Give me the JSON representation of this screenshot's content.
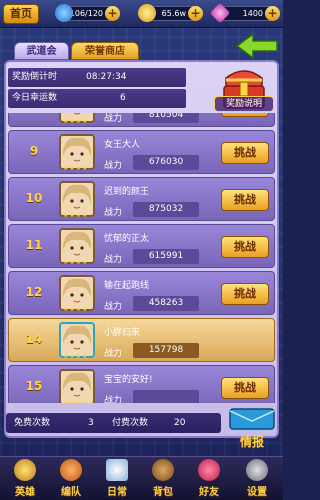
{
  "topbar": {
    "home_label": "首页",
    "stamina": "106/120",
    "gold": "65.6w",
    "diamond": "1400"
  },
  "tabs": {
    "arena": "武道会",
    "honor_shop": "荣誉商店"
  },
  "info": {
    "countdown_label": "奖励倒计时",
    "countdown_value": "08:27:34",
    "luck_label": "今日幸运数",
    "luck_value": "6",
    "reward_label": "奖励说明"
  },
  "rows": [
    {
      "rank": "",
      "name": "",
      "power_label": "战力",
      "power": "810504",
      "challenge": "挑战"
    },
    {
      "rank": "9",
      "name": "女王大人",
      "power_label": "战力",
      "power": "676030",
      "challenge": "挑战"
    },
    {
      "rank": "10",
      "name": "迟到的颜王",
      "power_label": "战力",
      "power": "875032",
      "challenge": "挑战"
    },
    {
      "rank": "11",
      "name": "忧郁的正太",
      "power_label": "战力",
      "power": "615991",
      "challenge": "挑战"
    },
    {
      "rank": "12",
      "name": "输在起跑线",
      "power_label": "战力",
      "power": "458263",
      "challenge": "挑战"
    },
    {
      "rank": "14",
      "name": "小胖归来",
      "power_label": "战力",
      "power": "157798",
      "challenge": ""
    },
    {
      "rank": "15",
      "name": "宝宝的安好!",
      "power_label": "战力",
      "power": "",
      "challenge": "挑战"
    }
  ],
  "counts": {
    "free_label": "免费次数",
    "free_value": "3",
    "paid_label": "付费次数",
    "paid_value": "20"
  },
  "intel_label": "情报",
  "nav": {
    "hero": "英雄",
    "team": "编队",
    "daily": "日常",
    "bag": "背包",
    "friends": "好友",
    "settings": "设置"
  },
  "colors": {
    "gold": "#ffd24a",
    "panel": "#c6bce8",
    "row": "#8a76c8",
    "highlight_row": "#e8c07a"
  }
}
